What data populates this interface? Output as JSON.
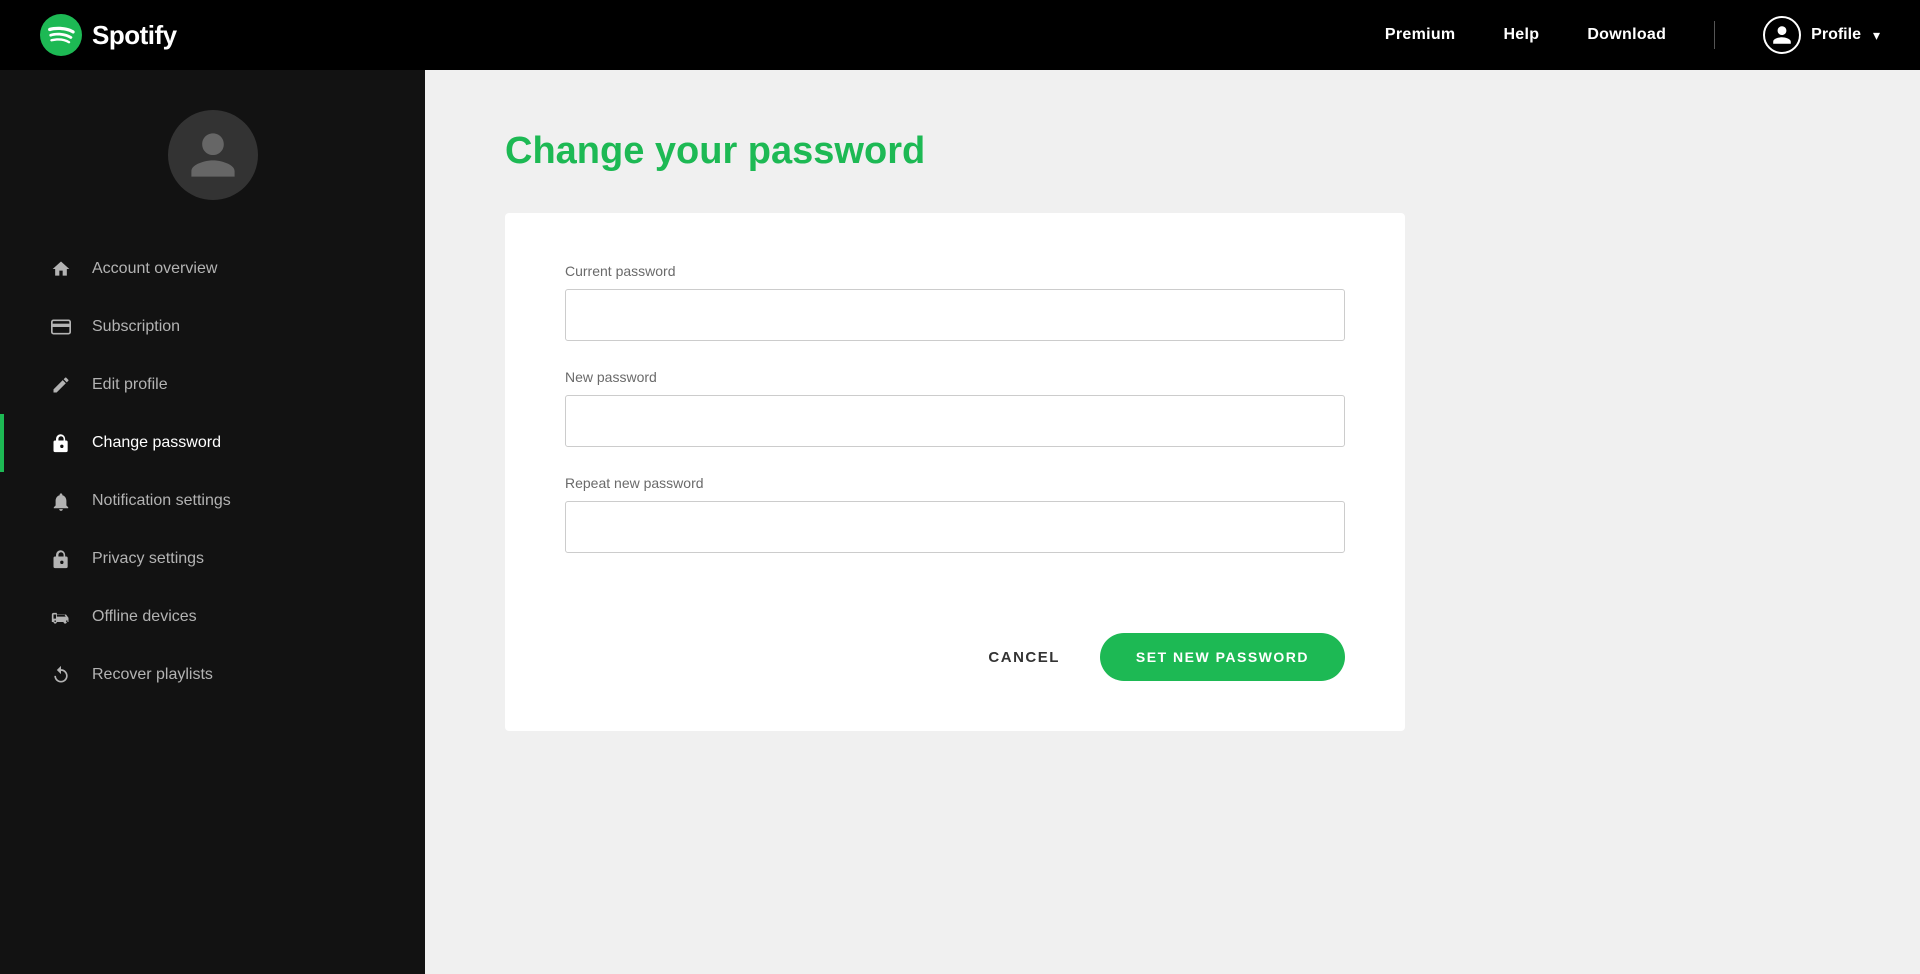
{
  "topnav": {
    "logo_text": "Spotify",
    "premium_label": "Premium",
    "help_label": "Help",
    "download_label": "Download",
    "profile_label": "Profile"
  },
  "sidebar": {
    "items": [
      {
        "id": "account-overview",
        "label": "Account overview",
        "icon": "home-icon",
        "active": false
      },
      {
        "id": "subscription",
        "label": "Subscription",
        "icon": "card-icon",
        "active": false
      },
      {
        "id": "edit-profile",
        "label": "Edit profile",
        "icon": "pencil-icon",
        "active": false
      },
      {
        "id": "change-password",
        "label": "Change password",
        "icon": "lock-icon",
        "active": true
      },
      {
        "id": "notification-settings",
        "label": "Notification settings",
        "icon": "bell-icon",
        "active": false
      },
      {
        "id": "privacy-settings",
        "label": "Privacy settings",
        "icon": "lock-icon-2",
        "active": false
      },
      {
        "id": "offline-devices",
        "label": "Offline devices",
        "icon": "devices-icon",
        "active": false
      },
      {
        "id": "recover-playlists",
        "label": "Recover playlists",
        "icon": "recover-icon",
        "active": false
      }
    ]
  },
  "main": {
    "page_title": "Change your password",
    "form": {
      "current_password_label": "Current password",
      "new_password_label": "New password",
      "repeat_password_label": "Repeat new password"
    },
    "cancel_label": "CANCEL",
    "set_password_label": "SET NEW PASSWORD"
  },
  "colors": {
    "green": "#1db954",
    "black": "#000000",
    "sidebar_bg": "#121212"
  }
}
